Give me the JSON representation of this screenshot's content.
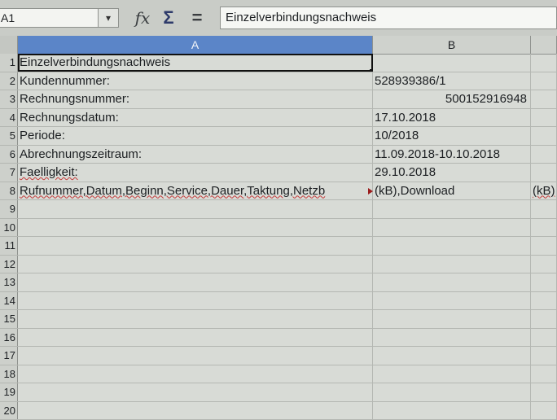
{
  "formula_bar": {
    "name_box": "A1",
    "fx_label": "fx",
    "sum_label": "Σ",
    "eq_label": "=",
    "content": "Einzelverbindungsnachweis"
  },
  "columns": [
    "A",
    "B",
    ""
  ],
  "rows": [
    {
      "n": "1",
      "a": "Einzelverbindungsnachweis",
      "b": "",
      "c": ""
    },
    {
      "n": "2",
      "a": "Kundennummer:",
      "b": "528939386/1",
      "c": ""
    },
    {
      "n": "3",
      "a": "Rechnungsnummer:",
      "b": "500152916948",
      "c": ""
    },
    {
      "n": "4",
      "a": "Rechnungsdatum:",
      "b": "17.10.2018",
      "c": ""
    },
    {
      "n": "5",
      "a": "Periode:",
      "b": "10/2018",
      "c": ""
    },
    {
      "n": "6",
      "a": "Abrechnungszeitraum:",
      "b": "11.09.2018-10.10.2018",
      "c": ""
    },
    {
      "n": "7",
      "a": "Faelligkeit:",
      "b": "29.10.2018",
      "c": ""
    },
    {
      "n": "8",
      "a": "Rufnummer,Datum,Beginn,Service,Dauer,Taktung,Netzb",
      "b": "(kB),Download",
      "c": "(kB)"
    },
    {
      "n": "9",
      "a": "",
      "b": "",
      "c": ""
    },
    {
      "n": "10",
      "a": "",
      "b": "",
      "c": ""
    },
    {
      "n": "11",
      "a": "",
      "b": "",
      "c": ""
    },
    {
      "n": "12",
      "a": "",
      "b": "",
      "c": ""
    },
    {
      "n": "13",
      "a": "",
      "b": "",
      "c": ""
    },
    {
      "n": "14",
      "a": "",
      "b": "",
      "c": ""
    },
    {
      "n": "15",
      "a": "",
      "b": "",
      "c": ""
    },
    {
      "n": "16",
      "a": "",
      "b": "",
      "c": ""
    },
    {
      "n": "17",
      "a": "",
      "b": "",
      "c": ""
    },
    {
      "n": "18",
      "a": "",
      "b": "",
      "c": ""
    },
    {
      "n": "19",
      "a": "",
      "b": "",
      "c": ""
    },
    {
      "n": "20",
      "a": "",
      "b": "",
      "c": ""
    }
  ]
}
